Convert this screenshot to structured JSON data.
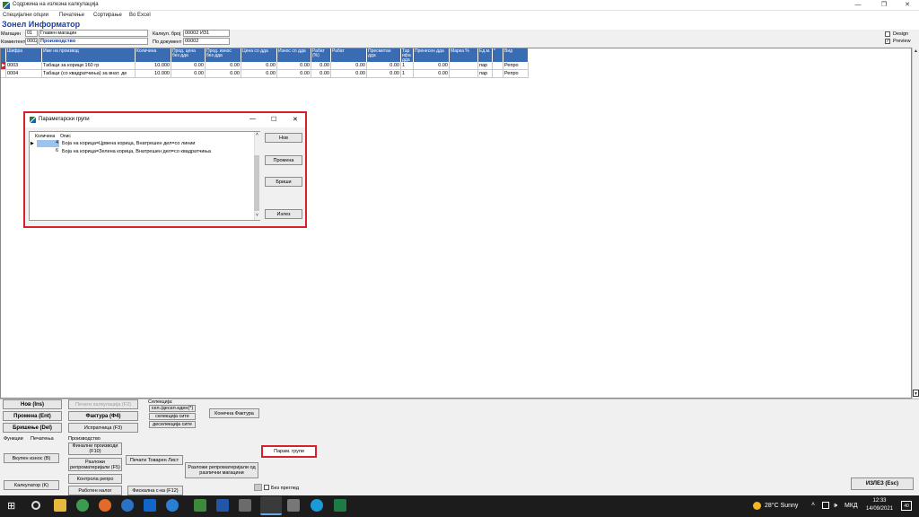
{
  "window": {
    "title": "Содржина на излезна калкулација",
    "minimize": "—",
    "restore": "❐",
    "close": "✕"
  },
  "menu": [
    "Специјални опции",
    "Печатење",
    "Сортирање",
    "Во Excel"
  ],
  "header": {
    "title": "Зонел Информатор",
    "magacin_label": "Магацин",
    "magacin_code": "01",
    "magacin_name": "Главен магацин",
    "komintent_label": "Коминтент",
    "komintent_code": "0002",
    "komintent_name": "Производство",
    "kalk_label": "Калкул. број",
    "kalk_value": "00002  ИЗ1",
    "dok_label": "По документ",
    "dok_value": "00002",
    "design_label": "Design",
    "preview_label": "Preview",
    "design_checked": false,
    "preview_checked": true
  },
  "grid": {
    "columns": [
      "Шифра",
      "Име на производ",
      "Количина",
      "Прод. цена без дда",
      "Прод. износ без дда",
      "Цена со дда",
      "Износ со дда",
      "Рабат (%)",
      "Рабат",
      "Пресметан дда",
      "Тар ифа дда",
      "Пренесен дда",
      "Марка %",
      "Ед.м.",
      "*",
      "Вид"
    ],
    "rows": [
      [
        "0003",
        "Табаци за корици 160 гр",
        "10.000",
        "0.00",
        "0.00",
        "0.00",
        "0.00",
        "0.00",
        "0.00",
        "0.00",
        "1",
        "0.00",
        "",
        "пар",
        "",
        "Репро"
      ],
      [
        "0004",
        "Табаци (со квадратчиња) за внат. де",
        "10.000",
        "0.00",
        "0.00",
        "0.00",
        "0.00",
        "0.00",
        "0.00",
        "0.00",
        "1",
        "0.00",
        "",
        "пар",
        "",
        "Репро"
      ]
    ]
  },
  "dialog": {
    "title": "Параметарски групи",
    "minimize": "—",
    "maximize": "☐",
    "close": "✕",
    "col_qty": "Количина",
    "col_desc": "Опис",
    "rows": [
      {
        "qty": "4",
        "desc": "Боја на корица=Црвена корица, Внатрешен дел=со линии"
      },
      {
        "qty": "6",
        "desc": "Боја на корица=Зелена корица, Внатрешен дел=со квадратчиња"
      }
    ],
    "btn_new": "Нов",
    "btn_edit": "Промена",
    "btn_delete": "Бриши",
    "btn_exit": "Излез"
  },
  "bottom": {
    "btn_new": "Нов (Ins)",
    "btn_edit": "Промена (Ent)",
    "btn_delete": "Бришење (Del)",
    "btn_print_calc": "Печати калкулација (F2)",
    "btn_invoice": "Фактура (Ф4)",
    "btn_dispatch": "Испратница (F3)",
    "selection_label": "Селекција:",
    "btn_sel_one": "сел./десел.еден(*)",
    "btn_sel_all": "селекција сите",
    "btn_desel_all": "деселекција сите",
    "btn_final_invoice": "Конечна Фактура",
    "tab_functions": "Функции",
    "tab_printing": "Печатења",
    "btn_purchase": "Вкупен износ (B)",
    "btn_calculator": "Калкулатор (K)",
    "production_label": "Производство",
    "btn_final_products": "Финални производи (F10)",
    "btn_breakdown": "Разложи репроматеријали (F5)",
    "btn_control": "Контрола репро",
    "btn_work_order": "Работен налог",
    "btn_print_list": "Печати Товарен Лист",
    "btn_fiscal": "Фискална с-ка (F12)",
    "btn_breakdown_multi": "Разложи репроматеријали од различни магацини",
    "btn_param_groups": "Парам. групи",
    "no_preview_label": "Без преглед",
    "btn_exit": "ИЗЛЕЗ (Esc)"
  },
  "taskbar": {
    "weather": "28°C  Sunny",
    "lang": "МКД",
    "time": "12:33",
    "date": "14/09/2021",
    "notif": "40"
  }
}
